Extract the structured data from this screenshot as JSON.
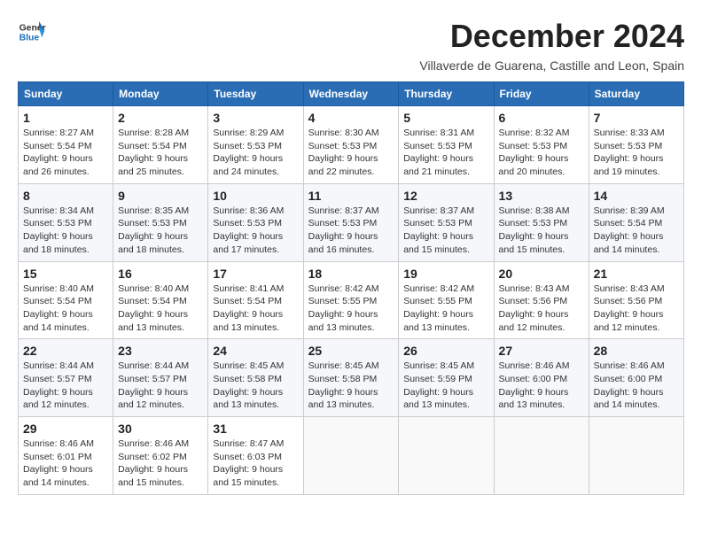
{
  "header": {
    "logo_general": "General",
    "logo_blue": "Blue",
    "month_title": "December 2024",
    "subtitle": "Villaverde de Guarena, Castille and Leon, Spain"
  },
  "weekdays": [
    "Sunday",
    "Monday",
    "Tuesday",
    "Wednesday",
    "Thursday",
    "Friday",
    "Saturday"
  ],
  "weeks": [
    [
      {
        "day": "1",
        "sunrise": "8:27 AM",
        "sunset": "5:54 PM",
        "daylight": "9 hours and 26 minutes."
      },
      {
        "day": "2",
        "sunrise": "8:28 AM",
        "sunset": "5:54 PM",
        "daylight": "9 hours and 25 minutes."
      },
      {
        "day": "3",
        "sunrise": "8:29 AM",
        "sunset": "5:53 PM",
        "daylight": "9 hours and 24 minutes."
      },
      {
        "day": "4",
        "sunrise": "8:30 AM",
        "sunset": "5:53 PM",
        "daylight": "9 hours and 22 minutes."
      },
      {
        "day": "5",
        "sunrise": "8:31 AM",
        "sunset": "5:53 PM",
        "daylight": "9 hours and 21 minutes."
      },
      {
        "day": "6",
        "sunrise": "8:32 AM",
        "sunset": "5:53 PM",
        "daylight": "9 hours and 20 minutes."
      },
      {
        "day": "7",
        "sunrise": "8:33 AM",
        "sunset": "5:53 PM",
        "daylight": "9 hours and 19 minutes."
      }
    ],
    [
      {
        "day": "8",
        "sunrise": "8:34 AM",
        "sunset": "5:53 PM",
        "daylight": "9 hours and 18 minutes."
      },
      {
        "day": "9",
        "sunrise": "8:35 AM",
        "sunset": "5:53 PM",
        "daylight": "9 hours and 18 minutes."
      },
      {
        "day": "10",
        "sunrise": "8:36 AM",
        "sunset": "5:53 PM",
        "daylight": "9 hours and 17 minutes."
      },
      {
        "day": "11",
        "sunrise": "8:37 AM",
        "sunset": "5:53 PM",
        "daylight": "9 hours and 16 minutes."
      },
      {
        "day": "12",
        "sunrise": "8:37 AM",
        "sunset": "5:53 PM",
        "daylight": "9 hours and 15 minutes."
      },
      {
        "day": "13",
        "sunrise": "8:38 AM",
        "sunset": "5:53 PM",
        "daylight": "9 hours and 15 minutes."
      },
      {
        "day": "14",
        "sunrise": "8:39 AM",
        "sunset": "5:54 PM",
        "daylight": "9 hours and 14 minutes."
      }
    ],
    [
      {
        "day": "15",
        "sunrise": "8:40 AM",
        "sunset": "5:54 PM",
        "daylight": "9 hours and 14 minutes."
      },
      {
        "day": "16",
        "sunrise": "8:40 AM",
        "sunset": "5:54 PM",
        "daylight": "9 hours and 13 minutes."
      },
      {
        "day": "17",
        "sunrise": "8:41 AM",
        "sunset": "5:54 PM",
        "daylight": "9 hours and 13 minutes."
      },
      {
        "day": "18",
        "sunrise": "8:42 AM",
        "sunset": "5:55 PM",
        "daylight": "9 hours and 13 minutes."
      },
      {
        "day": "19",
        "sunrise": "8:42 AM",
        "sunset": "5:55 PM",
        "daylight": "9 hours and 13 minutes."
      },
      {
        "day": "20",
        "sunrise": "8:43 AM",
        "sunset": "5:56 PM",
        "daylight": "9 hours and 12 minutes."
      },
      {
        "day": "21",
        "sunrise": "8:43 AM",
        "sunset": "5:56 PM",
        "daylight": "9 hours and 12 minutes."
      }
    ],
    [
      {
        "day": "22",
        "sunrise": "8:44 AM",
        "sunset": "5:57 PM",
        "daylight": "9 hours and 12 minutes."
      },
      {
        "day": "23",
        "sunrise": "8:44 AM",
        "sunset": "5:57 PM",
        "daylight": "9 hours and 12 minutes."
      },
      {
        "day": "24",
        "sunrise": "8:45 AM",
        "sunset": "5:58 PM",
        "daylight": "9 hours and 13 minutes."
      },
      {
        "day": "25",
        "sunrise": "8:45 AM",
        "sunset": "5:58 PM",
        "daylight": "9 hours and 13 minutes."
      },
      {
        "day": "26",
        "sunrise": "8:45 AM",
        "sunset": "5:59 PM",
        "daylight": "9 hours and 13 minutes."
      },
      {
        "day": "27",
        "sunrise": "8:46 AM",
        "sunset": "6:00 PM",
        "daylight": "9 hours and 13 minutes."
      },
      {
        "day": "28",
        "sunrise": "8:46 AM",
        "sunset": "6:00 PM",
        "daylight": "9 hours and 14 minutes."
      }
    ],
    [
      {
        "day": "29",
        "sunrise": "8:46 AM",
        "sunset": "6:01 PM",
        "daylight": "9 hours and 14 minutes."
      },
      {
        "day": "30",
        "sunrise": "8:46 AM",
        "sunset": "6:02 PM",
        "daylight": "9 hours and 15 minutes."
      },
      {
        "day": "31",
        "sunrise": "8:47 AM",
        "sunset": "6:03 PM",
        "daylight": "9 hours and 15 minutes."
      },
      null,
      null,
      null,
      null
    ]
  ]
}
